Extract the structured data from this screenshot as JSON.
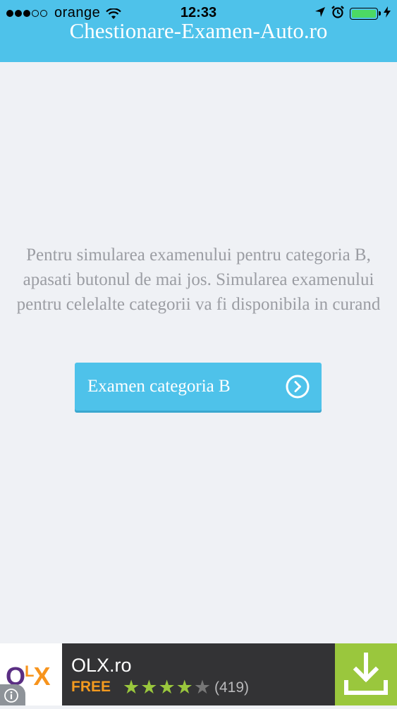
{
  "status_bar": {
    "carrier": "orange",
    "time": "12:33",
    "signal_bars_filled": 3,
    "signal_bars_total": 5,
    "battery_level": 1.0,
    "icons": [
      "signal-icon",
      "wifi-icon",
      "location-arrow-icon",
      "alarm-icon",
      "battery-icon",
      "charging-icon"
    ]
  },
  "header": {
    "title": "Chestionare-Examen-Auto.ro",
    "color": "#4ec2ea"
  },
  "main": {
    "message": "Pentru simularea examenului pentru categoria B, apasati butonul de mai jos. Simularea examenului pentru celelalte categorii va fi disponibila in curand",
    "button_label": "Examen categoria B",
    "button_icon": "chevron-right-circle-icon"
  },
  "ad": {
    "logo_text": [
      "O",
      "L",
      "X"
    ],
    "logo_colors": [
      "#5a2e83",
      "#f7941d",
      "#f7941d"
    ],
    "app_name": "OLX.ro",
    "price": "FREE",
    "rating_stars": 4,
    "rating_max": 5,
    "rating_count": "(419)",
    "info_icon": "info-icon",
    "download_icon": "download-icon",
    "download_color": "#9ac73d"
  }
}
